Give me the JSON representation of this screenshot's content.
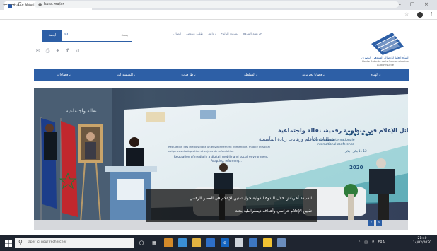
{
  "browser": {
    "tab_title": "Haute Autorité de la Communica...",
    "tab_close": "×",
    "new_tab": "+",
    "url": "haca.ma/ar",
    "nav": {
      "back": "←",
      "forward": "→",
      "reload": "C",
      "home": "⌂"
    },
    "window": {
      "minimize": "—",
      "maximize": "□",
      "close": "×"
    }
  },
  "site": {
    "search": {
      "button_label": "ابحث",
      "placeholder": "بحث"
    },
    "top_links": [
      "خريطة الموقع",
      "تصريح الولوج",
      "روابط",
      "طلب عروض",
      "اتصال"
    ],
    "logo_text": [
      "الهيأة العليا للاتصال السمعي البصري",
      "Haute Autorité de la Communication Audiovisuelle"
    ],
    "social_icons": [
      "mail-icon",
      "print-icon",
      "twitter-icon",
      "facebook-icon",
      "rss-icon"
    ],
    "nav": [
      {
        "label": "الهيأة",
        "has_chevron": true
      },
      {
        "label": "قضايا تحريرية",
        "has_chevron": true
      },
      {
        "label": "السلطة",
        "has_chevron": true
      },
      {
        "label": "ظرفيات",
        "has_chevron": true
      },
      {
        "label": "المنشورات",
        "has_chevron": true
      },
      {
        "label": "فضاءات",
        "has_chevron": true
      }
    ]
  },
  "hero": {
    "backdrop_left_title": "نقالة واجتماعية",
    "backdrop_ar_title": "تقنين وسائل الإعلام في منظومة رقمية، نقالة واجتماعية",
    "backdrop_ar_subtitle": "متطلبات التأقلم ورهانات زيادة المأسسة",
    "backdrop_fr_line1": "Régulation des médias dans un environnement numérique, mobile et social",
    "backdrop_fr_line2": "exigences d'adaptation et enjeux de refondation",
    "backdrop_en_line": "Regulation of media in a digital, mobile and social environment",
    "backdrop_en_line2": "Adapting, reforming...",
    "conference_ar": "ندوة دولية",
    "conference_fr": "Conférence internationale",
    "conference_en": "International conference",
    "conference_dates": "11-12 يناير - يناير",
    "conference_year": "2020",
    "caption_line1": "السيدة أخرباش خلال الندوة الدولية حول تقنين الإعلام في العصر الرقمي",
    "caption_line2": "تقنين الإعلام حراسي وأهداف ديمقراطية بحتة",
    "slider_prev": "‹",
    "slider_next": "›"
  },
  "taskbar": {
    "search_placeholder": "Taper ici pour rechercher",
    "language": "FRA",
    "time": "21:40",
    "date": "14/02/2020"
  },
  "colors": {
    "brand_blue": "#2d5fa6",
    "taskbar": "#1f2530"
  }
}
